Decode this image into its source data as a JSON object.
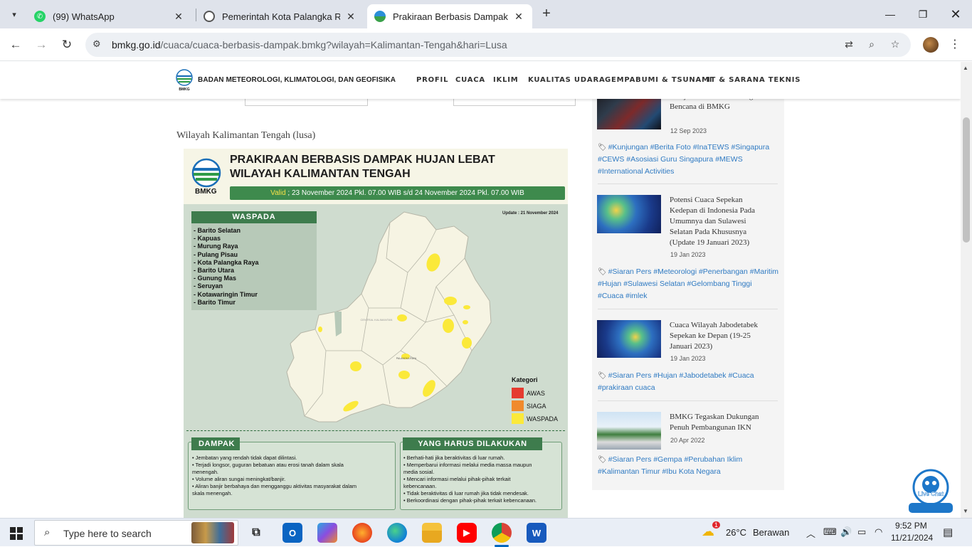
{
  "browser": {
    "tabs": [
      {
        "title": "(99) WhatsApp",
        "icon": "whatsapp-icon"
      },
      {
        "title": "Pemerintah Kota Palangka Raya",
        "icon": "globe-icon"
      },
      {
        "title": "Prakiraan Berbasis Dampak Wila",
        "icon": "bmkg-icon"
      }
    ],
    "url_host": "bmkg.go.id",
    "url_path": "/cuaca/cuaca-berbasis-dampak.bmkg?wilayah=Kalimantan-Tengah&hari=Lusa"
  },
  "site": {
    "org_name": "BADAN METEOROLOGI, KLIMATOLOGI, DAN GEOFISIKA",
    "logo_text": "BMKG",
    "menu": [
      "PROFIL",
      "CUACA",
      "IKLIM",
      "KUALITAS UDARA",
      "GEMPABUMI & TSUNAMI",
      "IT & SARANA TEKNIS"
    ]
  },
  "main": {
    "region_title": "Wilayah Kalimantan Tengah (lusa)"
  },
  "infographic": {
    "logo_text": "BMKG",
    "title_line1": "PRAKIRAAN BERBASIS DAMPAK HUJAN LEBAT",
    "title_line2": "WILAYAH KALIMANTAN TENGAH",
    "valid_label": "Valid",
    "valid_text": " ; 23 November 2024 Pkl. 07.00 WIB s/d 24 November 2024 Pkl. 07.00 WIB",
    "update": "Update : 21 November 2024",
    "waspada_header": "WASPADA",
    "waspada_list": [
      "- Barito Selatan",
      "- Kapuas",
      "- Murung Raya",
      "- Pulang Pisau",
      "- Kota Palangka Raya",
      "- Barito Utara",
      "- Gunung Mas",
      "- Seruyan",
      "- Kotawaringin Timur",
      "- Barito Timur"
    ],
    "map_label_region": "CENTRAL KALIMANTAN",
    "map_label_city": "PALANGKA RAYA",
    "legend_title": "Kategori",
    "legend": [
      {
        "label": "AWAS",
        "color": "#e53b30"
      },
      {
        "label": "SIAGA",
        "color": "#f08a2c"
      },
      {
        "label": "WASPADA",
        "color": "#fbe93a"
      }
    ],
    "dampak_header": "DAMPAK",
    "dampak": [
      "• Jembatan yang rendah tidak dapat dilintasi.",
      "• Terjadi longsor, guguran bebatuan atau erosi tanah dalam skala",
      "  menengah.",
      "• Volume aliran sungai meningkat/banjir.",
      "• Aliran banjir berbahaya dan mengganggu aktivitas masyarakat dalam",
      "  skala menengah."
    ],
    "action_header": "YANG HARUS DILAKUKAN",
    "actions": [
      "• Berhati-hati jika beraktivitas di luar rumah.",
      "• Memperbarui informasi melalui media massa maupun",
      "  media sosial.",
      "• Mencari informasi melalui pihak-pihak terkait",
      "  kebencanaan.",
      "• Tidak beraktivitas di luar rumah jika tidak mendesak.",
      "• Berkoordinasi dengan pihak-pihak terkait kebencanaan."
    ]
  },
  "sidebar": {
    "news": [
      {
        "title_lines": [
          "Belajar Sistem Monitoring",
          "Bencana di BMKG"
        ],
        "date": "12 Sep 2023",
        "tags": [
          "#Kunjungan",
          "#Berita Foto",
          "#InaTEWS",
          "#Singapura",
          "#CEWS",
          "#Asosiasi Guru Singapura",
          "#MEWS",
          "#International Activities"
        ]
      },
      {
        "title_lines": [
          "Potensi Cuaca Sepekan",
          "Kedepan di Indonesia Pada",
          "Umumnya dan Sulawesi",
          "Selatan Pada Khususnya",
          "(Update 19 Januari 2023)"
        ],
        "date": "19 Jan 2023",
        "tags": [
          "#Siaran Pers",
          "#Meteorologi",
          "#Penerbangan",
          "#Maritim",
          "#Hujan",
          "#Sulawesi Selatan",
          "#Gelombang Tinggi",
          "#Cuaca",
          "#imlek"
        ]
      },
      {
        "title_lines": [
          "Cuaca Wilayah Jabodetabek",
          "Sepekan ke Depan (19-25",
          "Januari 2023)"
        ],
        "date": "19 Jan 2023",
        "tags": [
          "#Siaran Pers",
          "#Hujan",
          "#Jabodetabek",
          "#Cuaca",
          "#prakiraan cuaca"
        ]
      },
      {
        "title_lines": [
          "BMKG Tegaskan Dukungan",
          "Penuh Pembangunan IKN"
        ],
        "date": "20 Apr 2022",
        "tags": [
          "#Siaran Pers",
          "#Gempa",
          "#Perubahan Iklim",
          "#Kalimantan Timur",
          "#Ibu Kota Negara"
        ]
      }
    ]
  },
  "live_chat": {
    "label": "Live Chat"
  },
  "taskbar": {
    "search_placeholder": "Type here to search",
    "weather_temp": "26°C",
    "weather_desc": "Berawan",
    "weather_badge": "1",
    "time": "9:52 PM",
    "date": "11/21/2024",
    "apps": [
      "task-view-icon",
      "outlook-icon",
      "copilot-icon",
      "firefox-icon",
      "edge-icon",
      "file-explorer-icon",
      "youtube-icon",
      "chrome-icon",
      "word-icon"
    ]
  }
}
